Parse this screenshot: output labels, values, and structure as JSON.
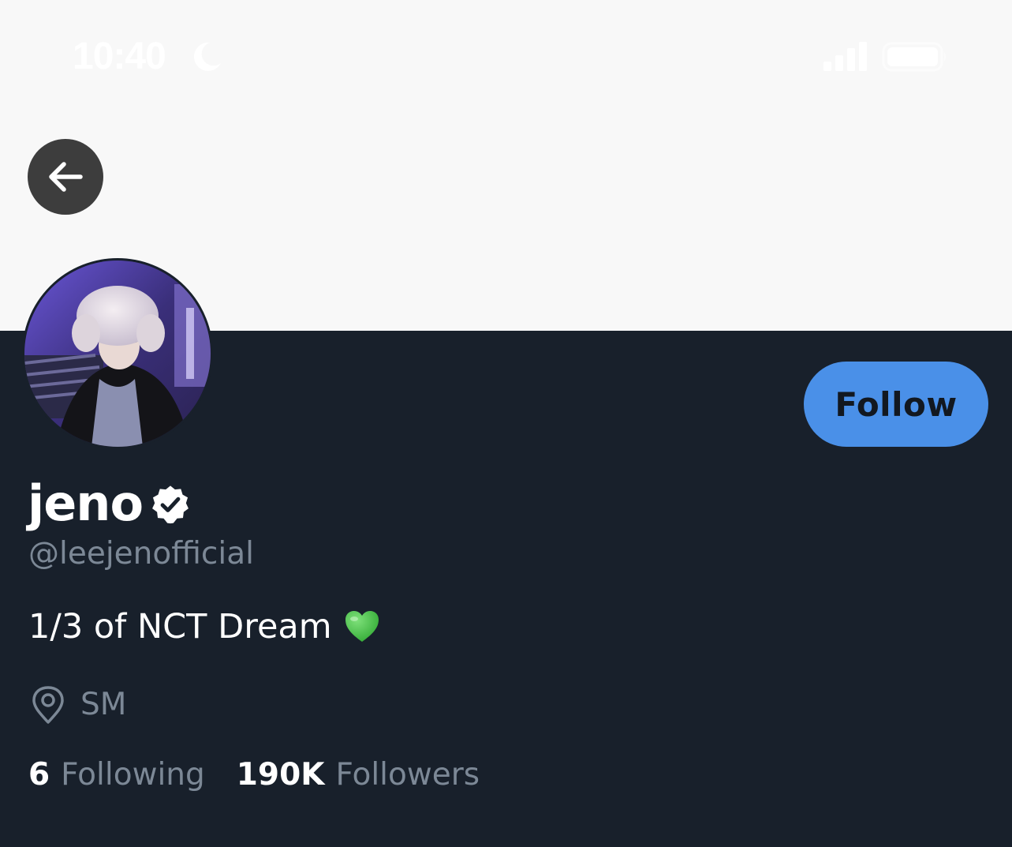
{
  "status_bar": {
    "time": "10:40",
    "icons": [
      "moon-icon",
      "signal-icon",
      "battery-icon"
    ]
  },
  "navigation": {
    "back_icon": "arrow-left-icon"
  },
  "profile": {
    "display_name": "jeno",
    "verified": true,
    "handle": "@leejenofficial",
    "bio": "1/3 of NCT Dream",
    "bio_emoji": "green-heart-icon",
    "location": "SM",
    "follow_label": "Follow",
    "stats": {
      "following_count": "6",
      "following_label": "Following",
      "followers_count": "190K",
      "followers_label": "Followers"
    }
  },
  "colors": {
    "banner": "#f8f8f8",
    "background": "#18202b",
    "accent": "#4a90e8",
    "secondary_text": "#7c8896",
    "primary_text": "#ffffff",
    "heart": "#3fbf3f"
  }
}
